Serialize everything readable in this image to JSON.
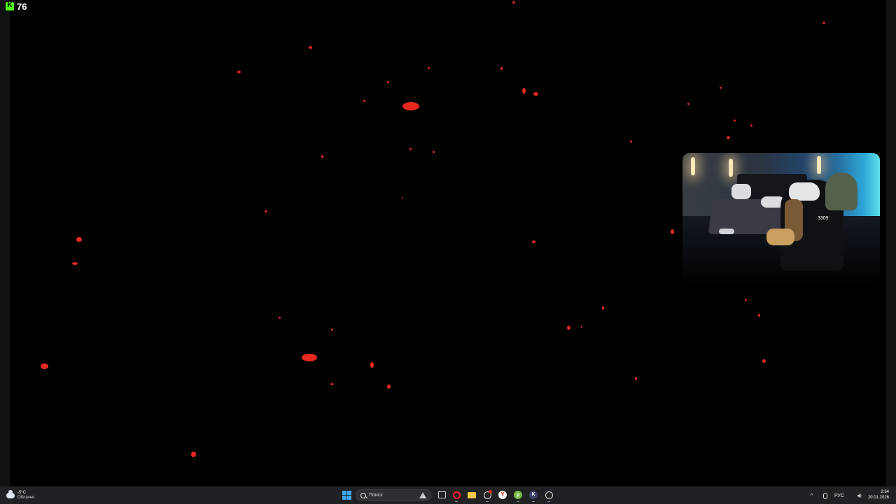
{
  "overlay": {
    "kick_icon": "kick-logo-icon",
    "kick_letter": "K",
    "viewer_count": "76"
  },
  "webcam": {
    "overlay_text": "3309"
  },
  "taskbar": {
    "weather": {
      "icon": "cloud-icon",
      "temperature": "-5°C",
      "condition": "Облачно"
    },
    "search_placeholder": "Поиск",
    "apps": [
      {
        "name": "task-view-icon"
      },
      {
        "name": "opera-icon"
      },
      {
        "name": "file-explorer-icon"
      },
      {
        "name": "browser-badge-icon"
      },
      {
        "name": "yandex-browser-icon"
      },
      {
        "name": "utorrent-icon"
      },
      {
        "name": "app-k-icon"
      },
      {
        "name": "obs-icon"
      }
    ],
    "tray": {
      "chevron": "^",
      "mic_icon": "microphone-icon",
      "language": "РУС",
      "speaker_icon": "speaker-icon"
    },
    "clock": {
      "time": "2:34",
      "date": "20.01.2026"
    }
  },
  "colors": {
    "particle": "#e8291f",
    "taskbar_bg": "#1f2124",
    "kick_green": "#53fc18"
  }
}
